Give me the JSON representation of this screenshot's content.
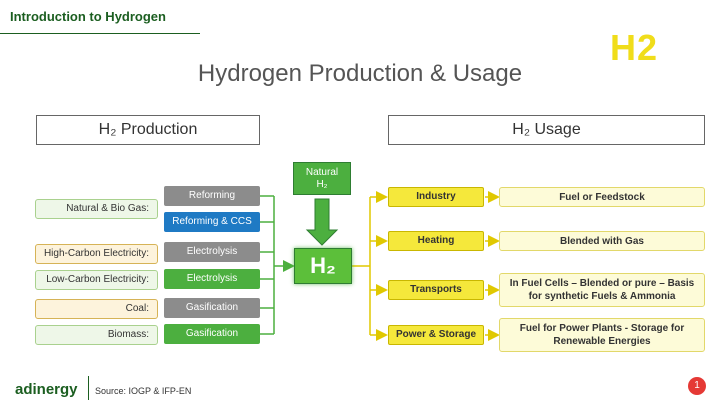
{
  "header": {
    "title": "Introduction to Hydrogen",
    "logo_text": "H2"
  },
  "main_title": "Hydrogen Production & Usage",
  "sections": {
    "production": "H₂ Production",
    "usage": "H₂ Usage"
  },
  "sources": [
    {
      "label": "Natural & Bio Gas:",
      "color": "green"
    },
    {
      "label": "High-Carbon Electricity:",
      "color": "yellow"
    },
    {
      "label": "Low-Carbon Electricity:",
      "color": "green"
    },
    {
      "label": "Coal:",
      "color": "yellow"
    },
    {
      "label": "Biomass:",
      "color": "green"
    }
  ],
  "processes": [
    {
      "label": "Reforming",
      "color": "#8c8c8c"
    },
    {
      "label": "Reforming & CCS",
      "color": "#1f7ac4"
    },
    {
      "label": "Electrolysis",
      "color": "#8c8c8c"
    },
    {
      "label": "Electrolysis",
      "color": "#4caf3f"
    },
    {
      "label": "Gasification",
      "color": "#8c8c8c"
    },
    {
      "label": "Gasification",
      "color": "#4caf3f"
    }
  ],
  "natural_h2": {
    "line1": "Natural",
    "line2": "H₂"
  },
  "center": "H₂",
  "usages": [
    {
      "label": "Industry",
      "outcome": "Fuel or Feedstock"
    },
    {
      "label": "Heating",
      "outcome": "Blended with Gas"
    },
    {
      "label": "Transports",
      "outcome": "In Fuel Cells – Blended or pure – Basis for synthetic Fuels & Ammonia"
    },
    {
      "label": "Power & Storage",
      "outcome": "Fuel for Power Plants - Storage for Renewable Energies"
    }
  ],
  "footer": {
    "logo": "adinergy",
    "source": "Source: IOGP & IFP-EN",
    "page": "1"
  },
  "colors": {
    "accent_green": "#4caf3f",
    "dark_green": "#1b5e20",
    "yellow": "#f5e83b",
    "blue": "#1f7ac4",
    "gray": "#8c8c8c"
  }
}
